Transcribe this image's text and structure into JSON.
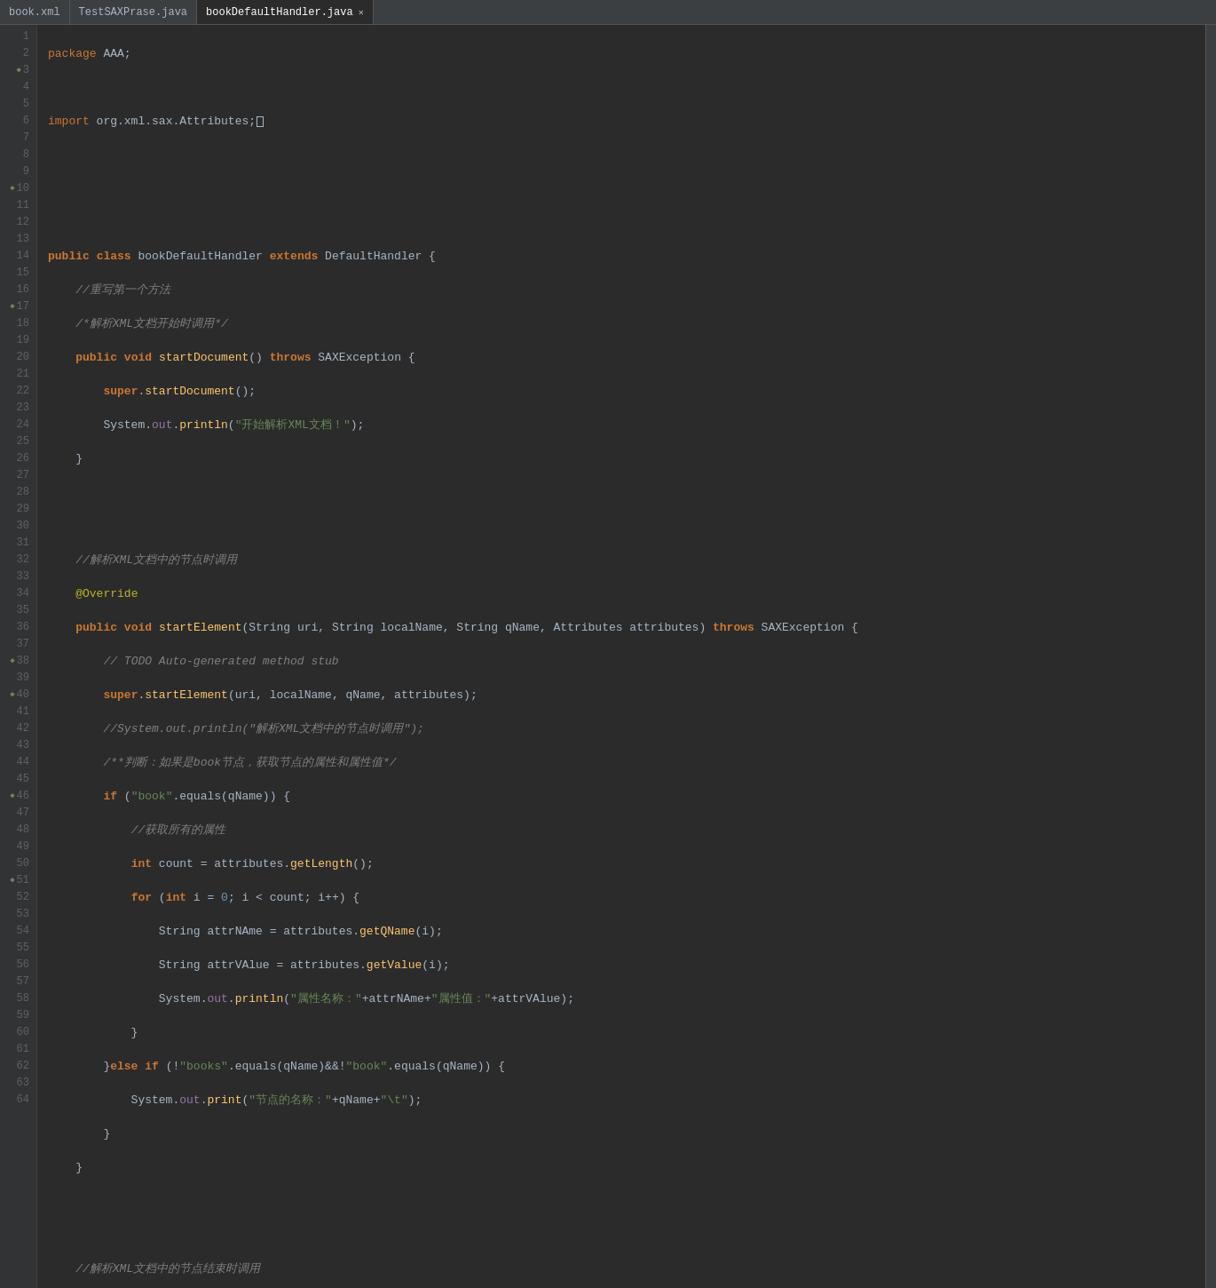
{
  "tabs": [
    {
      "label": "book.xml",
      "active": false,
      "closable": false
    },
    {
      "label": "TestSAXPrase.java",
      "active": false,
      "closable": false
    },
    {
      "label": "bookDefaultHandler.java",
      "active": true,
      "closable": true
    }
  ],
  "lines": {
    "total": 64
  }
}
